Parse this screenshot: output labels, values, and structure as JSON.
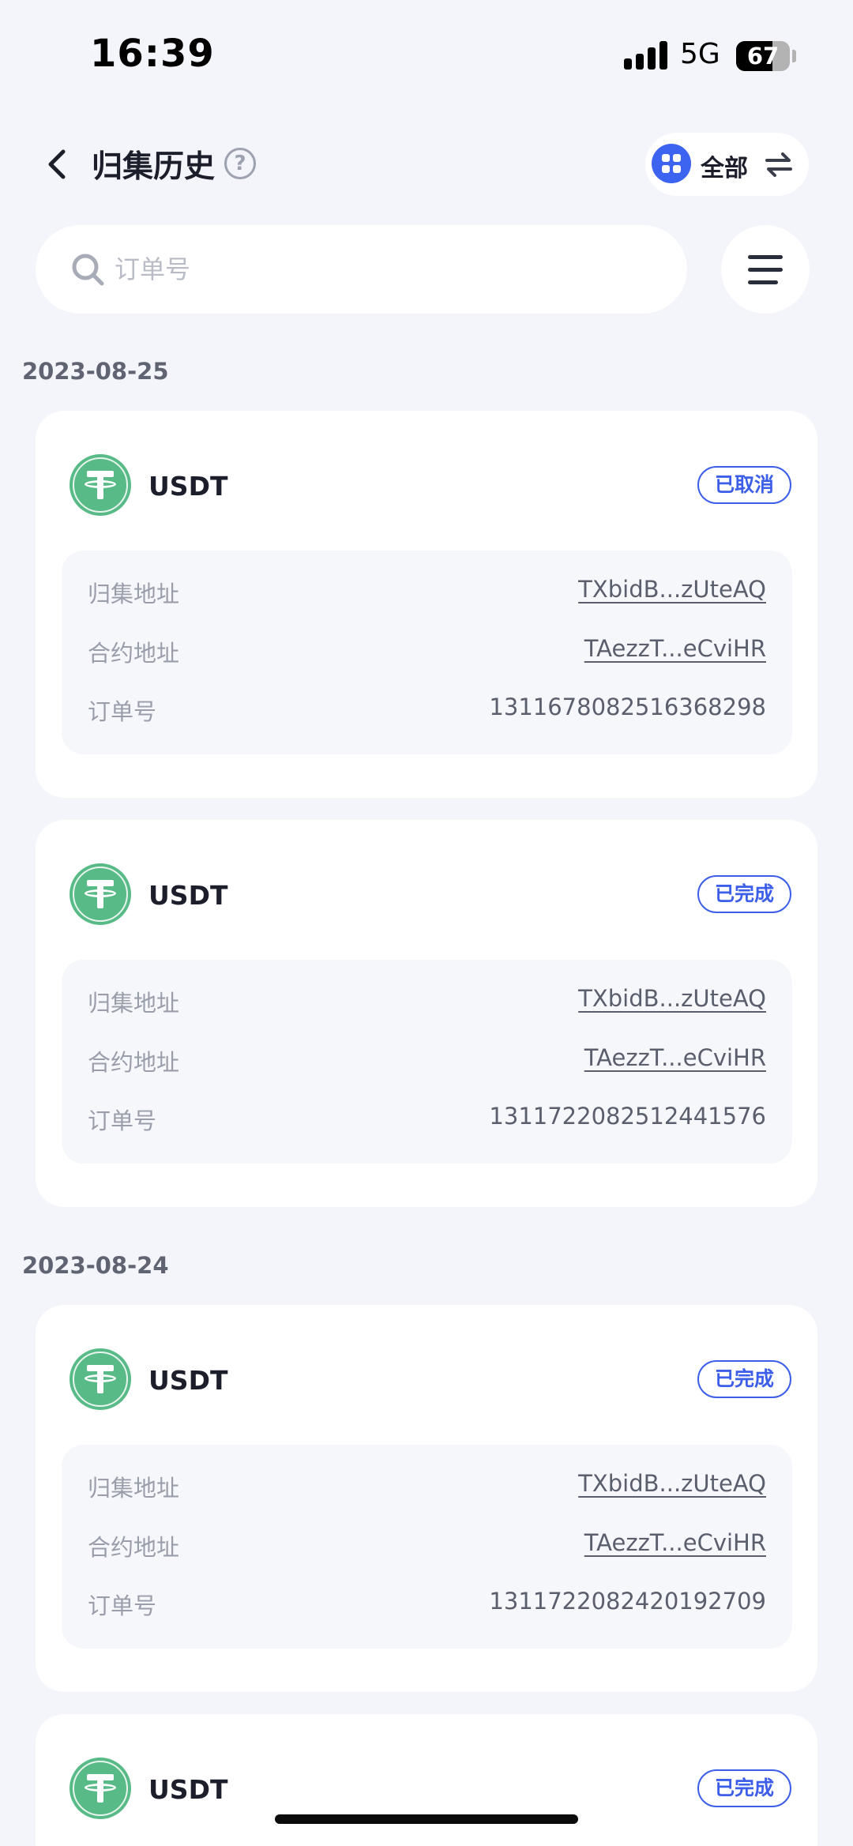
{
  "status_bar": {
    "time": "16:39",
    "network": "5G",
    "battery": "67",
    "battery_level": 0.67
  },
  "header": {
    "title": "归集历史",
    "help": "?",
    "filter_label": "全部"
  },
  "search": {
    "placeholder": "订单号",
    "value": ""
  },
  "groups": [
    {
      "date": "2023-08-25",
      "records": [
        {
          "token": "USDT",
          "status": "已取消",
          "collect_label": "归集地址",
          "collect_address": "TXbidB...zUteAQ",
          "contract_label": "合约地址",
          "contract_address": "TAezzT...eCviHR",
          "order_label": "订单号",
          "order_no": "1311678082516368298"
        },
        {
          "token": "USDT",
          "status": "已完成",
          "collect_label": "归集地址",
          "collect_address": "TXbidB...zUteAQ",
          "contract_label": "合约地址",
          "contract_address": "TAezzT...eCviHR",
          "order_label": "订单号",
          "order_no": "1311722082512441576"
        }
      ]
    },
    {
      "date": "2023-08-24",
      "records": [
        {
          "token": "USDT",
          "status": "已完成",
          "collect_label": "归集地址",
          "collect_address": "TXbidB...zUteAQ",
          "contract_label": "合约地址",
          "contract_address": "TAezzT...eCviHR",
          "order_label": "订单号",
          "order_no": "1311722082420192709"
        },
        {
          "token": "USDT",
          "status": "已完成"
        }
      ]
    }
  ],
  "colors": {
    "accent": "#3c5ee8",
    "token_green": "#58ba87",
    "background": "#f3f5fb"
  }
}
